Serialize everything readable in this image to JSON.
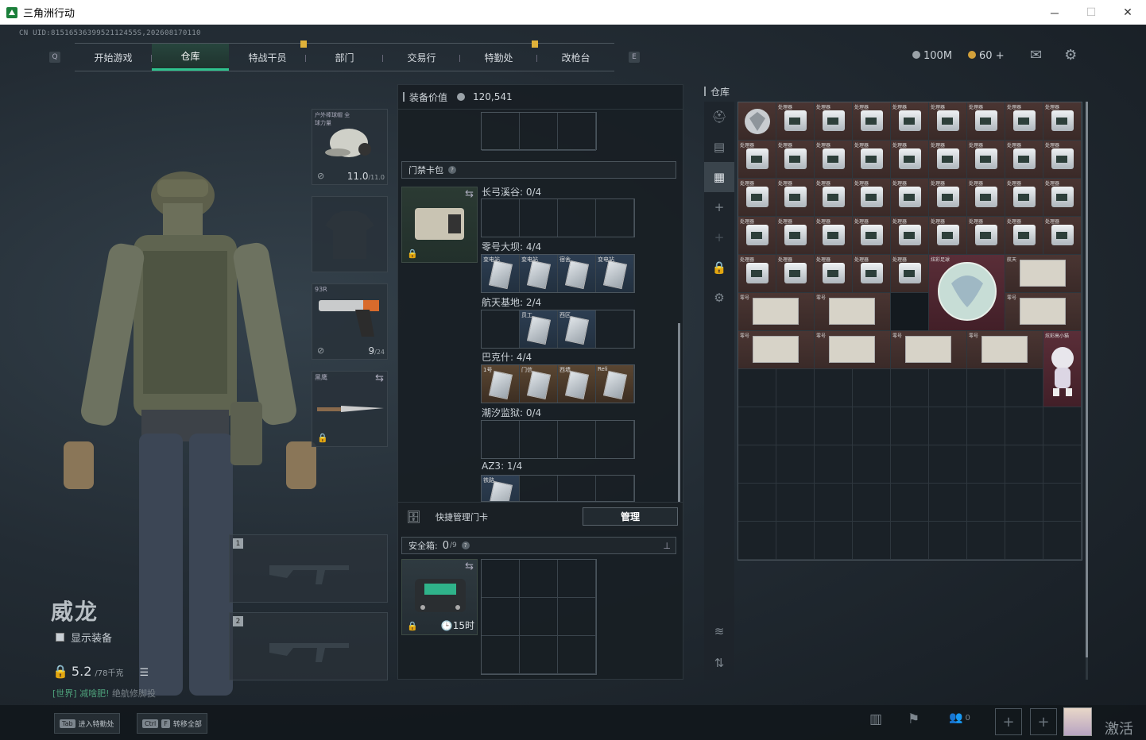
{
  "window": {
    "title": "三角洲行动",
    "minimize": "─",
    "maximize": "☐",
    "close": "✕"
  },
  "uid": "CN UID:8151653639952112455S,202608170110",
  "nav": {
    "left_key": "Q",
    "right_key": "E",
    "tabs": [
      {
        "label": "开始游戏"
      },
      {
        "label": "仓库"
      },
      {
        "label": "特战干员"
      },
      {
        "label": "部门"
      },
      {
        "label": "交易行"
      },
      {
        "label": "特勤处"
      },
      {
        "label": "改枪台"
      }
    ]
  },
  "currency": {
    "hafu": "100M",
    "coins": "60",
    "plus": "+"
  },
  "character": {
    "name": "威龙",
    "show_gear": "显示装备",
    "weight": "5.2",
    "weight_max": "/78千克",
    "chat_channel": "[世界]",
    "chat_text": "减啥肥!",
    "chat_extra": "绝航修脚投"
  },
  "gear_slots": {
    "helmet": {
      "label": "户外棒球帽 全球力量",
      "durability": "11.0",
      "durability_max": "/11.0"
    },
    "pistol": {
      "label": "93R",
      "ammo": "9",
      "ammo_max": "/24"
    },
    "melee": {
      "label": "黑鹰"
    },
    "weapon1_num": "1",
    "weapon2_num": "2"
  },
  "middle": {
    "equip_value_label": "装备价值",
    "equip_value": "120,541",
    "keycard_pack": "门禁卡包",
    "maps": [
      {
        "name": "长弓溪谷: 0/4"
      },
      {
        "name": "零号大坝: 4/4"
      },
      {
        "name": "航天基地: 2/4"
      },
      {
        "name": "巴克什: 4/4"
      },
      {
        "name": "潮汐监狱: 0/4"
      },
      {
        "name": "AZ3: 1/4"
      }
    ],
    "card_tags": {
      "dam": [
        "变电站",
        "变电站",
        "宿舍",
        "变电站"
      ],
      "space": [
        "员工",
        "西区"
      ],
      "baksh": [
        "1号",
        "门信",
        "西墙",
        "Reli"
      ],
      "az3": [
        "铁路"
      ]
    },
    "quick_manage": "快捷管理门卡",
    "manage_btn": "管理",
    "safebox_label": "安全箱:",
    "safebox_value": "0",
    "safebox_max": "/9",
    "safebox_time": "15时"
  },
  "warehouse": {
    "title": "仓库",
    "item_tag": "处理器",
    "big_items": {
      "ball": "炫彩足球",
      "space": "航天",
      "doll": "炫彩高小猫"
    },
    "map_tag": "零号"
  },
  "bottom": {
    "tab_key": "Tab",
    "tab_label": "进入特勤处",
    "ctrl_key": "Ctrl",
    "f_key": "F",
    "transfer_label": "转移全部",
    "friends": "0",
    "activate": "激活"
  }
}
